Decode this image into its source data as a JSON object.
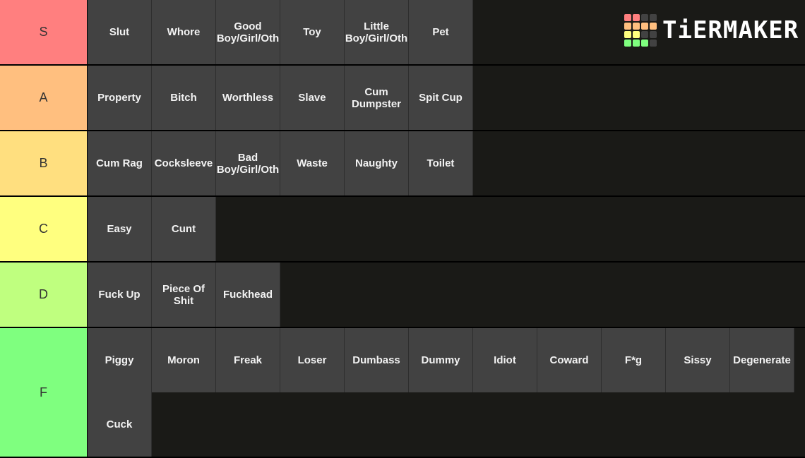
{
  "brand": {
    "name": "TiERMAKER",
    "logo_grid_colors": [
      "#ff7f7f",
      "#ff7f7f",
      "#424242",
      "#424242",
      "#ffbf7f",
      "#ffbf7f",
      "#ffbf7f",
      "#ffbf7f",
      "#ffff7f",
      "#ffff7f",
      "#424242",
      "#424242",
      "#7fff7f",
      "#7fff7f",
      "#7fff7f",
      "#424242"
    ]
  },
  "tiers": [
    {
      "label": "S",
      "color": "#ff7f7f",
      "items": [
        "Slut",
        "Whore",
        "Good Boy/Girl/Oth",
        "Toy",
        "Little Boy/Girl/Oth",
        "Pet"
      ]
    },
    {
      "label": "A",
      "color": "#ffbf7f",
      "items": [
        "Property",
        "Bitch",
        "Worthless",
        "Slave",
        "Cum Dumpster",
        "Spit Cup"
      ]
    },
    {
      "label": "B",
      "color": "#ffdf7f",
      "items": [
        "Cum Rag",
        "Cocksleeve",
        "Bad Boy/Girl/Oth",
        "Waste",
        "Naughty",
        "Toilet"
      ]
    },
    {
      "label": "C",
      "color": "#ffff7f",
      "items": [
        "Easy",
        "Cunt"
      ]
    },
    {
      "label": "D",
      "color": "#bfff7f",
      "items": [
        "Fuck Up",
        "Piece Of Shit",
        "Fuckhead"
      ]
    },
    {
      "label": "F",
      "color": "#7fff7f",
      "items": [
        "Piggy",
        "Moron",
        "Freak",
        "Loser",
        "Dumbass",
        "Dummy",
        "Idiot",
        "Coward",
        "F*g",
        "Sissy",
        "Degenerate",
        "Cuck"
      ]
    }
  ]
}
